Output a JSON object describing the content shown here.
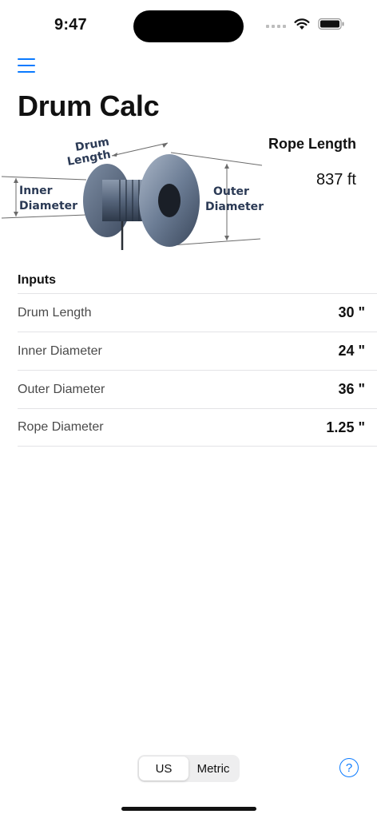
{
  "status_bar": {
    "time": "9:47"
  },
  "header": {
    "title": "Drum Calc"
  },
  "diagram": {
    "drum_length_label_1": "Drum",
    "drum_length_label_2": "Length",
    "inner_label_1": "Inner",
    "inner_label_2": "Diameter",
    "outer_label_1": "Outer",
    "outer_label_2": "Diameter"
  },
  "result": {
    "label": "Rope Length",
    "value": "837 ft"
  },
  "inputs": {
    "header": "Inputs",
    "rows": [
      {
        "label": "Drum Length",
        "value": "30 \""
      },
      {
        "label": "Inner Diameter",
        "value": "24 \""
      },
      {
        "label": "Outer Diameter",
        "value": "36 \""
      },
      {
        "label": "Rope Diameter",
        "value": "1.25 \""
      }
    ]
  },
  "units": {
    "options": [
      "US",
      "Metric"
    ],
    "selected": "US"
  },
  "help": {
    "symbol": "?"
  },
  "colors": {
    "accent": "#0a7aff",
    "drum": "#5f7088",
    "drum_dark": "#2f3a4c"
  }
}
